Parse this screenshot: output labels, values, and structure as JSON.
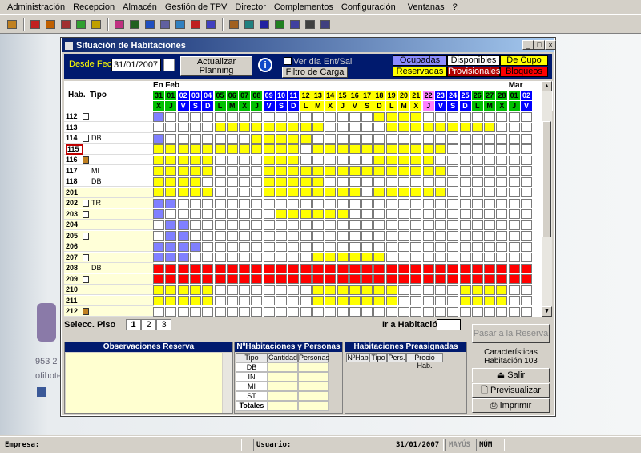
{
  "menu": [
    "Administración",
    "Recepcion",
    "Almacén",
    "Gestión de TPV",
    "Director",
    "Complementos",
    "Configuración",
    "Ventanas",
    "?"
  ],
  "background": {
    "phone": "953 2",
    "brand": "ofihote"
  },
  "window": {
    "title": "Situación de Habitaciones"
  },
  "header": {
    "desde_fecha_label": "Desde Fecha",
    "date_value": "31/01/2007",
    "update_button": "Actualizar Planning",
    "info_icon": "i",
    "checkbox_label": "Ver día Ent/Sal",
    "filter_button": "Filtro de Carga"
  },
  "legend": [
    {
      "label": "Ocupadas",
      "color": "#8c8cff",
      "text": "#000"
    },
    {
      "label": "Disponibles",
      "color": "#ffffff",
      "text": "#000"
    },
    {
      "label": "De Cupo",
      "color": "#ffff00",
      "text": "#000"
    },
    {
      "label": "Reservadas",
      "color": "#ffff00",
      "text": "#000"
    },
    {
      "label": "Provisionales",
      "color": "#b00000",
      "text": "#fff"
    },
    {
      "label": "Bloqueos",
      "color": "#ff0000",
      "text": "#000"
    }
  ],
  "grid": {
    "col_hab": "Hab.",
    "col_tipo": "Tipo",
    "months": [
      {
        "label": "En"
      },
      {
        "label": "Feb"
      },
      {
        "label": "Mar"
      }
    ],
    "days": [
      "31",
      "01",
      "02",
      "03",
      "04",
      "05",
      "06",
      "07",
      "08",
      "09",
      "10",
      "11",
      "12",
      "13",
      "14",
      "15",
      "16",
      "17",
      "18",
      "19",
      "20",
      "21",
      "22",
      "23",
      "24",
      "25",
      "26",
      "27",
      "28",
      "01",
      "02"
    ],
    "weekdays": [
      "X",
      "J",
      "V",
      "S",
      "D",
      "L",
      "M",
      "X",
      "J",
      "V",
      "S",
      "D",
      "L",
      "M",
      "X",
      "J",
      "V",
      "S",
      "D",
      "L",
      "M",
      "X",
      "J",
      "V",
      "S",
      "D",
      "L",
      "M",
      "X",
      "J",
      "V"
    ],
    "day_colors": [
      "#00c000",
      "#00c000",
      "#0000ff",
      "#0000ff",
      "#0000ff",
      "#00c000",
      "#00c000",
      "#00c000",
      "#00c000",
      "#0000ff",
      "#0000ff",
      "#0000ff",
      "#ffff00",
      "#ffff00",
      "#ffff00",
      "#ffff00",
      "#ffff00",
      "#ffff00",
      "#ffff00",
      "#ffff00",
      "#ffff00",
      "#ffff00",
      "#ff80ff",
      "#0000ff",
      "#0000ff",
      "#0000ff",
      "#00c000",
      "#00c000",
      "#00c000",
      "#00c000",
      "#0000ff"
    ],
    "rooms": [
      {
        "hab": "112",
        "tipo": "",
        "icon": "person-icon",
        "cells": "O......................................"
      },
      {
        "hab": "113",
        "tipo": "",
        "icon": "",
        "cells": "..........RRRR.........RRRRR......"
      },
      {
        "hab": "114",
        "tipo": "DB",
        "icon": "person-icon",
        "cells": "O......................................"
      },
      {
        "hab": "115",
        "tipo": "",
        "icon": "",
        "cells": "RRRRRRRRRRRR"
      },
      {
        "hab": "116",
        "tipo": "",
        "icon": "luggage-icon",
        "cells": "RRRRR"
      },
      {
        "hab": "117",
        "tipo": "MI",
        "icon": "",
        "cells": "RRRRR"
      },
      {
        "hab": "118",
        "tipo": "DB",
        "icon": "",
        "cells": "RRRR"
      },
      {
        "hab": "201",
        "tipo": "",
        "icon": "",
        "cells": "RRRRR"
      },
      {
        "hab": "202",
        "tipo": "TR",
        "icon": "person-icon",
        "cells": "OO"
      },
      {
        "hab": "203",
        "tipo": "",
        "icon": "person-icon",
        "cells": "O"
      },
      {
        "hab": "204",
        "tipo": "",
        "icon": "",
        "cells": ".OO"
      },
      {
        "hab": "205",
        "tipo": "",
        "icon": "person-icon",
        "cells": ".OO"
      },
      {
        "hab": "206",
        "tipo": "",
        "icon": "",
        "cells": "OOOO"
      },
      {
        "hab": "207",
        "tipo": "",
        "icon": "person-icon",
        "cells": "OOO"
      },
      {
        "hab": "208",
        "tipo": "DB",
        "icon": "",
        "cells": "BBBBBBBBBBBBBBBBBBBBBBBBBBBBBBB"
      },
      {
        "hab": "209",
        "tipo": "",
        "icon": "person-icon",
        "cells": "BBBBBBBBBBBBBBBBBBBBBBBBBBBBBBB"
      },
      {
        "hab": "210",
        "tipo": "",
        "icon": "",
        "cells": "RRRRR"
      },
      {
        "hab": "211",
        "tipo": "",
        "icon": "",
        "cells": "RRRRR"
      },
      {
        "hab": "212",
        "tipo": "",
        "icon": "luggage-icon",
        "cells": ""
      }
    ]
  },
  "floor": {
    "label": "Selecc. Piso",
    "options": [
      "1",
      "2",
      "3"
    ]
  },
  "goto": {
    "label": "Ir a Habitación",
    "value": ""
  },
  "obs": {
    "title": "Observaciones Reserva"
  },
  "hp": {
    "title": "NºHabitaciones y Personas",
    "headers": [
      "Tipo Hab.",
      "Cantidad",
      "Personas"
    ],
    "rows": [
      "DB",
      "IN",
      "MI",
      "ST",
      "Totales"
    ]
  },
  "pre": {
    "title": "Habitaciones Preasignadas",
    "headers": [
      "NºHab",
      "Tipo",
      "Pers.",
      "Precio Hab."
    ]
  },
  "actions": {
    "pasar": "Pasar a la Reserva",
    "caract": "Características Habitación 103",
    "salir": "Salir",
    "previsualizar": "Previsualizar",
    "imprimir": "Imprimir"
  },
  "status": {
    "empresa": "Empresa:",
    "usuario": "Usuario:",
    "date": "31/01/2007",
    "mayus": "MAYÚS",
    "num": "NÚM"
  }
}
